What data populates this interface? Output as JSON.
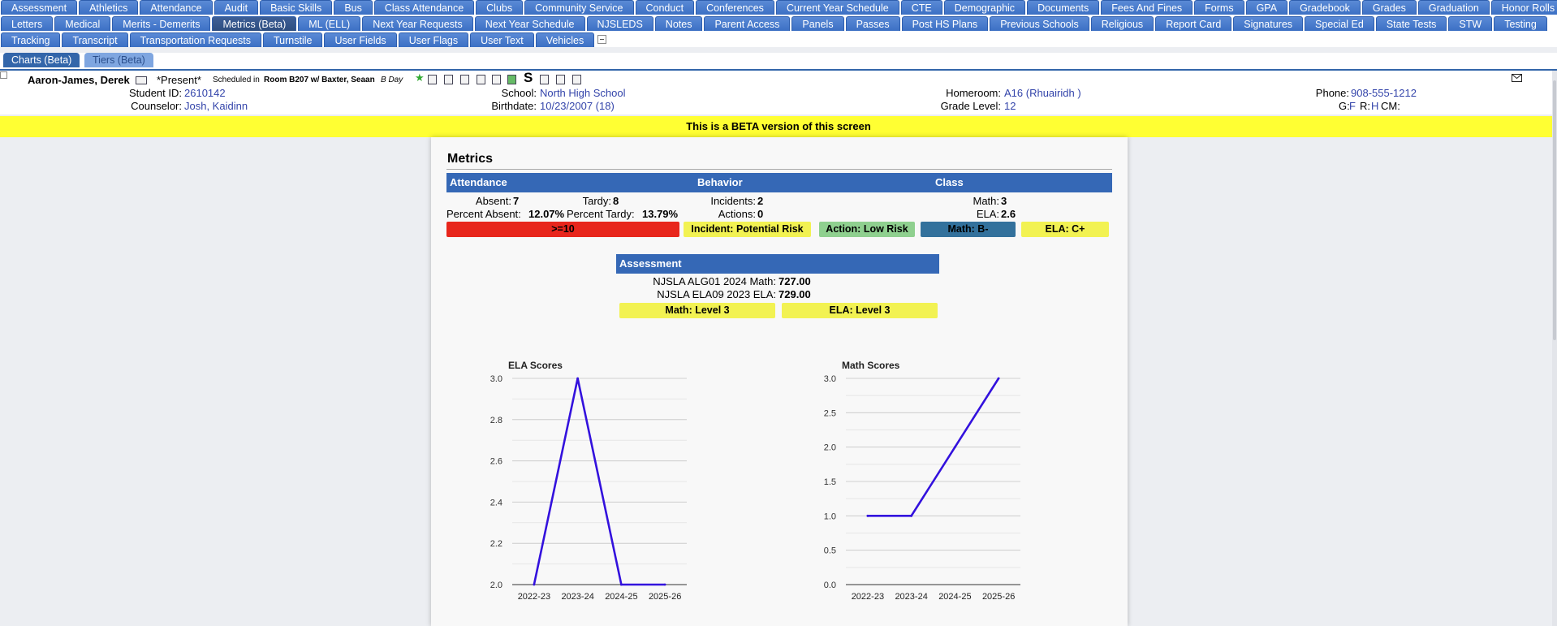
{
  "tabs": {
    "row1": [
      "Assessment",
      "Athletics",
      "Attendance",
      "Audit",
      "Basic Skills",
      "Bus",
      "Class Attendance",
      "Clubs",
      "Community Service",
      "Conduct",
      "Conferences",
      "Current Year Schedule",
      "CTE",
      "Demographic",
      "Documents",
      "Fees And Fines",
      "Forms",
      "GPA",
      "Gradebook",
      "Grades",
      "Graduation",
      "Honor Rolls"
    ],
    "row2": [
      "Letters",
      "Medical",
      "Merits - Demerits",
      "Metrics (Beta)",
      "ML (ELL)",
      "Next Year Requests",
      "Next Year Schedule",
      "NJSLEDS",
      "Notes",
      "Parent Access",
      "Panels",
      "Passes",
      "Post HS Plans",
      "Previous Schools",
      "Religious",
      "Report Card",
      "Signatures",
      "Special Ed",
      "State Tests",
      "STW",
      "Testing"
    ],
    "row3": [
      "Tracking",
      "Transcript",
      "Transportation Requests",
      "Turnstile",
      "User Fields",
      "User Flags",
      "User Text",
      "Vehicles"
    ],
    "active": "Metrics (Beta)"
  },
  "subtabs": [
    "Charts (Beta)",
    "Tiers (Beta)"
  ],
  "student": {
    "name": "Aaron-James, Derek",
    "status": "*Present*",
    "scheduled_prefix": "Scheduled in",
    "scheduled_room": "Room B207 w/ Baxter, Seaan",
    "day": "B Day",
    "student_id_label": "Student ID:",
    "student_id": "2610142",
    "counselor_label": "Counselor:",
    "counselor": "Josh, Kaidinn",
    "school_label": "School:",
    "school": "North High School",
    "birthdate_label": "Birthdate:",
    "birthdate": "10/23/2007 (18)",
    "homeroom_label": "Homeroom:",
    "homeroom": "A16 (Rhuairidh )",
    "grade_label": "Grade Level:",
    "grade": "12",
    "phone_label": "Phone:",
    "phone": "908-555-1212",
    "g_label": "G:",
    "g_value": "F",
    "r_label": "R:",
    "r_value": "H",
    "cm_label": "CM:",
    "s_glyph": "S"
  },
  "banner": "This is a BETA version of this screen",
  "metrics": {
    "title": "Metrics",
    "headers": {
      "attendance": "Attendance",
      "behavior": "Behavior",
      "class": "Class"
    },
    "absent_label": "Absent:",
    "absent": "7",
    "tardy_label": "Tardy:",
    "tardy": "8",
    "pct_absent_label": "Percent Absent:",
    "pct_absent": "12.07%",
    "pct_tardy_label": "Percent Tardy:",
    "pct_tardy": "13.79%",
    "incidents_label": "Incidents:",
    "incidents": "2",
    "actions_label": "Actions:",
    "actions": "0",
    "math_label": "Math:",
    "math": "3",
    "ela_label": "ELA:",
    "ela": "2.6",
    "pills": {
      "attendance": "&gt;=10",
      "incident": "Incident: Potential Risk",
      "action": "Action: Low Risk",
      "math": "Math: B-",
      "ela": "ELA: C+"
    },
    "colors": {
      "red": "#e8261c",
      "yellow": "#f2f252",
      "green": "#8fd08f",
      "blue": "#33719c",
      "header": "#3568b6"
    }
  },
  "assessment": {
    "header": "Assessment",
    "math_label": "NJSLA ALG01 2024 Math:",
    "math": "727.00",
    "ela_label": "NJSLA ELA09 2023 ELA:",
    "ela": "729.00",
    "pill_math": "Math: Level 3",
    "pill_ela": "ELA: Level 3"
  },
  "chart_data": [
    {
      "type": "line",
      "title": "ELA Scores",
      "categories": [
        "2022-23",
        "2023-24",
        "2024-25",
        "2025-26"
      ],
      "series": [
        {
          "values": [
            2.0,
            3.0,
            2.0,
            2.0
          ]
        }
      ],
      "ylim": [
        2.0,
        3.0
      ],
      "yticks": [
        "3.0",
        "2.8",
        "2.6",
        "2.4",
        "2.2",
        "2.0"
      ],
      "grid": true,
      "color": "#3311dd"
    },
    {
      "type": "line",
      "title": "Math Scores",
      "categories": [
        "2022-23",
        "2023-24",
        "2024-25",
        "2025-26"
      ],
      "series": [
        {
          "values": [
            1.0,
            1.0,
            2.0,
            3.0
          ]
        }
      ],
      "ylim": [
        0.0,
        3.0
      ],
      "yticks": [
        "3.0",
        "2.5",
        "2.0",
        "1.5",
        "1.0",
        "0.5",
        "0.0"
      ],
      "grid": true,
      "color": "#3311dd"
    }
  ],
  "icons": [
    "star-icon",
    "document-icon",
    "document-icon",
    "document-icon",
    "grid-icon",
    "copy-icon",
    "photo-icon",
    "s-icon",
    "monitor-icon",
    "id-card-icon",
    "save-icon",
    "mail-icon"
  ]
}
